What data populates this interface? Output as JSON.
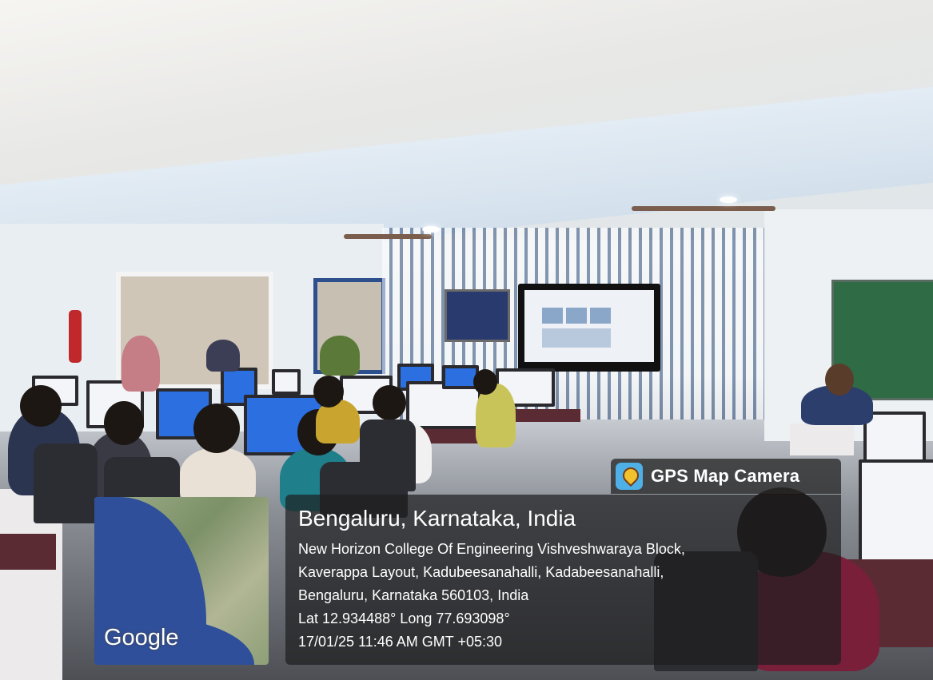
{
  "gps_overlay": {
    "app_icon": "map-pin-icon",
    "app_name": "GPS Map Camera",
    "place": "Bengaluru, Karnataka, India",
    "address_line_1": "New Horizon College Of Engineering Vishveshwaraya Block,",
    "address_line_2": "Kaverappa Layout, Kadubeesanahalli, Kadabeesanahalli,",
    "address_line_3": "Bengaluru, Karnataka 560103, India",
    "coordinates": "Lat 12.934488° Long 77.693098°",
    "datetime": "17/01/25 11:46 AM GMT +05:30"
  },
  "map_thumbnail": {
    "attribution": "Google"
  },
  "colors": {
    "overlay_bg": "#1e1e20",
    "overlay_text": "#ffffff",
    "map_sea": "#2f4f9a"
  }
}
